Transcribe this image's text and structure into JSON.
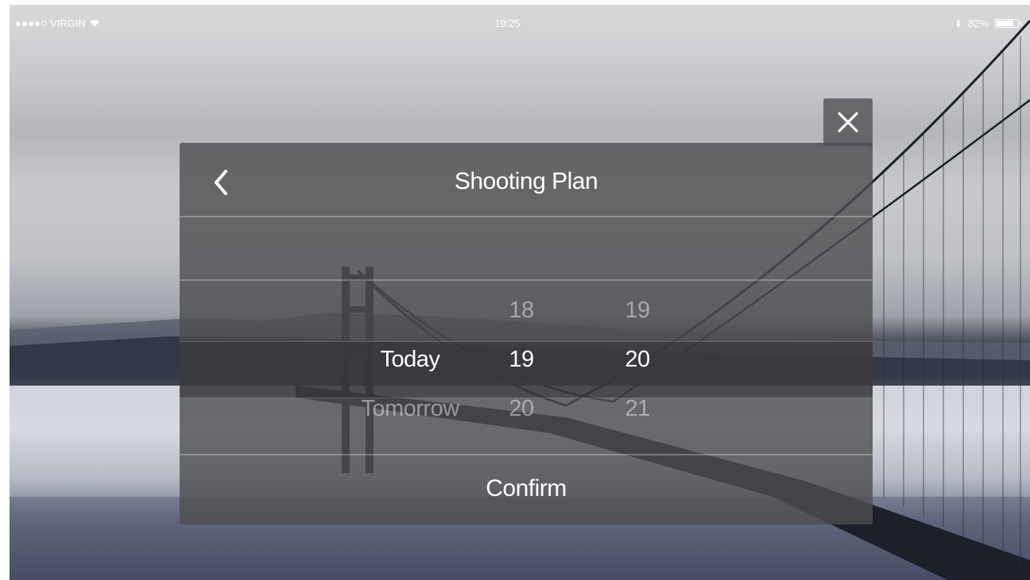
{
  "status_bar": {
    "carrier": "VIRGIN",
    "time": "19:25",
    "battery_percent": "82%",
    "battery_level": 0.82,
    "signal_icon": "signal-dots-icon",
    "wifi_icon": "wifi-icon",
    "bluetooth_icon": "bluetooth-icon",
    "battery_icon": "battery-icon"
  },
  "dialog": {
    "title": "Shooting Plan",
    "back_icon": "chevron-left-icon",
    "close_icon": "close-icon",
    "confirm_label": "Confirm"
  },
  "picker": {
    "day_column": {
      "items": [
        "",
        "Today",
        "Tomorrow"
      ],
      "selected": "Today"
    },
    "hour_column": {
      "items": [
        "18",
        "19",
        "20"
      ],
      "selected": "19"
    },
    "minute_column": {
      "items": [
        "19",
        "20",
        "21"
      ],
      "selected": "20"
    }
  },
  "colors": {
    "dialog_background": "#4e4e50",
    "text_primary": "#ffffff",
    "text_dim": "#ffffff73"
  }
}
